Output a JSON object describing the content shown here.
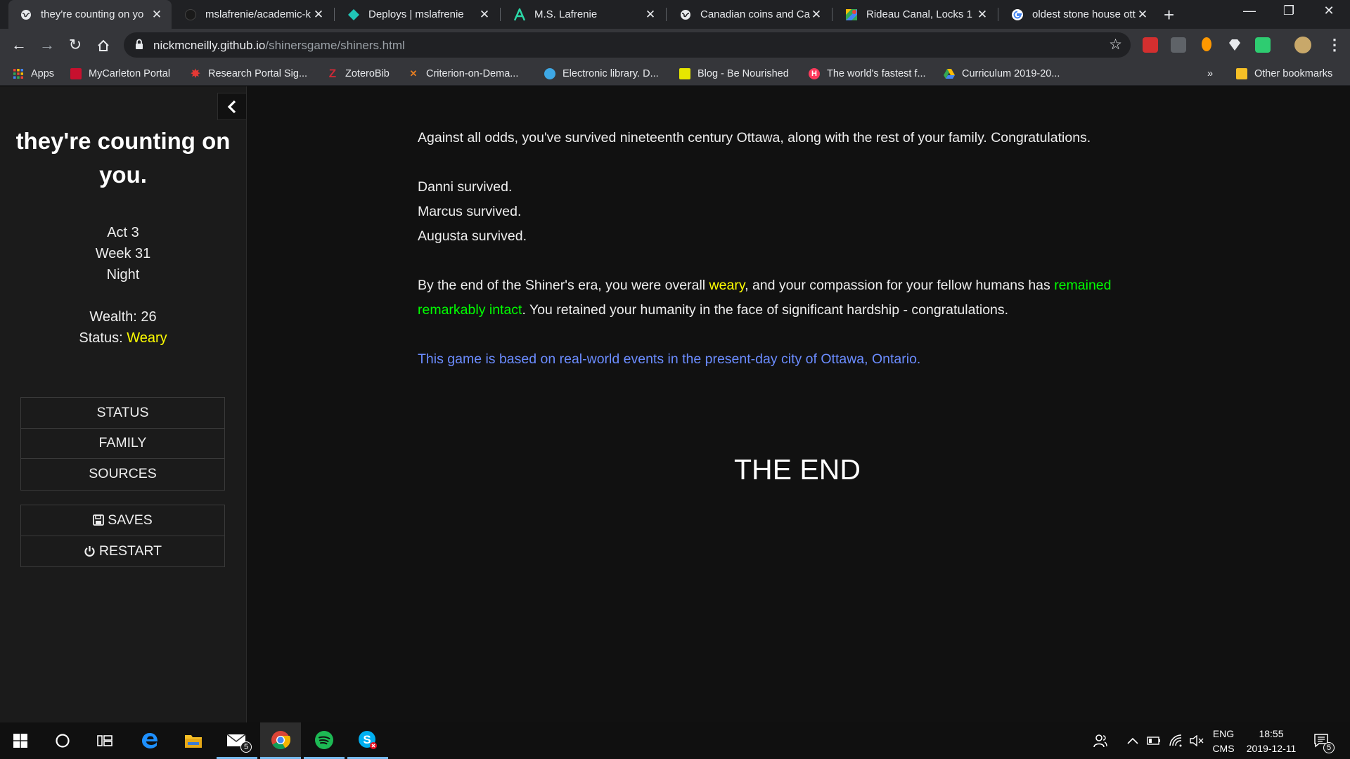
{
  "browser": {
    "tabs": [
      {
        "title": "they're counting on yo",
        "icon": "globe-icon",
        "active": true
      },
      {
        "title": "mslafrenie/academic-k",
        "icon": "github-icon",
        "active": false
      },
      {
        "title": "Deploys | mslafrenie",
        "icon": "netlify-icon",
        "active": false
      },
      {
        "title": "M.S. Lafrenie",
        "icon": "site-a-icon",
        "active": false
      },
      {
        "title": "Canadian coins and Ca",
        "icon": "globe-icon",
        "active": false
      },
      {
        "title": "Rideau Canal, Locks 1",
        "icon": "maps-icon",
        "active": false
      },
      {
        "title": "oldest stone house ott",
        "icon": "google-icon",
        "active": false
      }
    ],
    "new_tab_label": "+",
    "url_host": "nickmcneilly.github.io",
    "url_path": "/shinersgame/shiners.html",
    "bookmarks": [
      {
        "label": "Apps",
        "icon": "apps-grid-icon"
      },
      {
        "label": "MyCarleton Portal",
        "icon": "carleton-icon"
      },
      {
        "label": "Research Portal Sig...",
        "icon": "maple-leaf-icon"
      },
      {
        "label": "ZoteroBib",
        "icon": "zotero-icon"
      },
      {
        "label": "Criterion-on-Dema...",
        "icon": "criterion-icon"
      },
      {
        "label": "Electronic library. D...",
        "icon": "library-icon"
      },
      {
        "label": "Blog - Be Nourished",
        "icon": "blog-icon"
      },
      {
        "label": "The world's fastest f...",
        "icon": "hotjar-icon"
      },
      {
        "label": "Curriculum 2019-20...",
        "icon": "drive-icon"
      }
    ],
    "bookmarks_overflow": "»",
    "other_bookmarks": "Other bookmarks"
  },
  "sidebar": {
    "title": "they're counting on you.",
    "act": "Act 3",
    "week": "Week 31",
    "time_of_day": "Night",
    "wealth_label": "Wealth: 26",
    "status_label": "Status: ",
    "status_value": "Weary",
    "menu": [
      {
        "label": "STATUS"
      },
      {
        "label": "FAMILY"
      },
      {
        "label": "SOURCES"
      }
    ],
    "menu2": [
      {
        "label": "SAVES",
        "icon": "floppy-disk-icon"
      },
      {
        "label": "RESTART",
        "icon": "power-icon"
      }
    ]
  },
  "passage": {
    "intro": "Against all odds, you've survived nineteenth century Ottawa, along with the rest of your family. Congratulations.",
    "survivors": [
      "Danni survived.",
      "Marcus survived.",
      "Augusta survived."
    ],
    "summary_a": "By the end of the Shiner's era, you were overall ",
    "summary_status": "weary",
    "summary_b": ", and your compassion for your fellow humans has ",
    "summary_compassion": "remained remarkably intact",
    "summary_c": ". You retained your humanity in the face of significant hardship - congratulations.",
    "source_note": "This game is based on real-world events in the present-day city of Ottawa, Ontario.",
    "the_end": "THE END"
  },
  "taskbar": {
    "mail_badge": "5",
    "language_top": "ENG",
    "language_bottom": "CMS",
    "time": "18:55",
    "date": "2019-12-11",
    "notifications_badge": "5"
  },
  "colors": {
    "status_yellow": "#ffff00",
    "compassion_green": "#00ff00",
    "link_blue": "#6b8cff",
    "page_bg": "#111111",
    "sidebar_bg": "#1b1b1b"
  }
}
